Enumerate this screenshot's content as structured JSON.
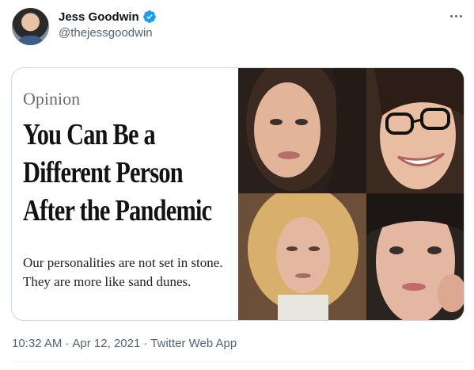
{
  "author": {
    "display_name": "Jess Goodwin",
    "handle": "@thejessgoodwin",
    "verified": true
  },
  "icons": {
    "verified": "verified-badge-icon",
    "more": "more-options-icon"
  },
  "card": {
    "kicker": "Opinion",
    "headline": "You Can Be a Different Person After the Pandemic",
    "summary": "Our personalities are not set in stone. They are more like sand dunes."
  },
  "meta": {
    "time": "10:32 AM",
    "separator": "·",
    "date": "Apr 12, 2021",
    "source": "Twitter Web App"
  },
  "colors": {
    "verified": "#1d9bf0",
    "secondary_text": "#536471",
    "card_border": "#cfd9de"
  }
}
